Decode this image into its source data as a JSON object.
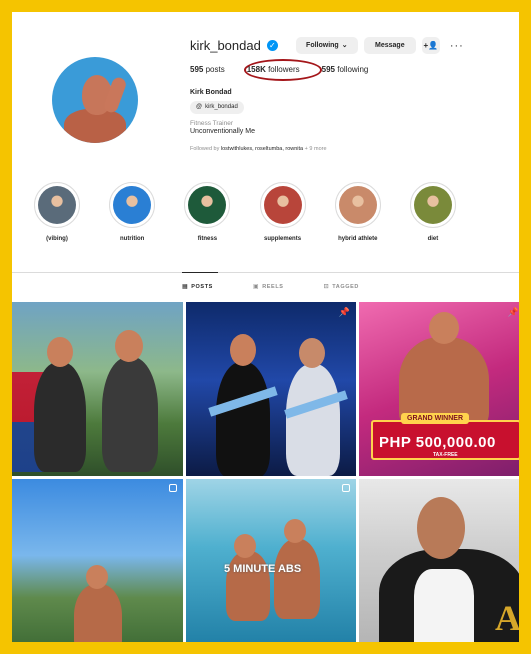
{
  "profile": {
    "username": "kirk_bondad",
    "full_name": "Kirk Bondad",
    "threads_handle": "kirk_bondad",
    "category": "Fitness Trainer",
    "bio": "Unconventionally Me",
    "followed_by_prefix": "Followed by",
    "followed_by_names": "lostwithlukes, roseltumba, rownita",
    "followed_by_suffix": "+ 9 more"
  },
  "actions": {
    "following_label": "Following",
    "message_label": "Message",
    "suggest_icon": "person-add-icon",
    "more_icon": "more-horizontal-icon"
  },
  "stats": {
    "posts_count": "595",
    "posts_label": "posts",
    "followers_count": "158K",
    "followers_label": "followers",
    "following_count": "595",
    "following_label": "following"
  },
  "highlights": [
    {
      "label": "(vibing)",
      "color": "#5a6b7a"
    },
    {
      "label": "nutrition",
      "color": "#2a7fd4"
    },
    {
      "label": "fitness",
      "color": "#1e5a3a"
    },
    {
      "label": "supplements",
      "color": "#b8453a"
    },
    {
      "label": "hybrid athlete",
      "color": "#c98a6a"
    },
    {
      "label": "diet",
      "color": "#7a8a3a"
    }
  ],
  "tabs": [
    {
      "label": "POSTS",
      "icon": "grid-icon",
      "active": true
    },
    {
      "label": "REELS",
      "icon": "reels-icon",
      "active": false
    },
    {
      "label": "TAGGED",
      "icon": "tagged-icon",
      "active": false
    }
  ],
  "posts": {
    "post3_sign_top": "GRAND WINNER",
    "post3_sign_amount": "PHP 500,000.00",
    "post3_sign_bottom": "TAX-FREE",
    "post5_text": "5 MINUTE ABS"
  },
  "annotation_color": "#a4161a"
}
